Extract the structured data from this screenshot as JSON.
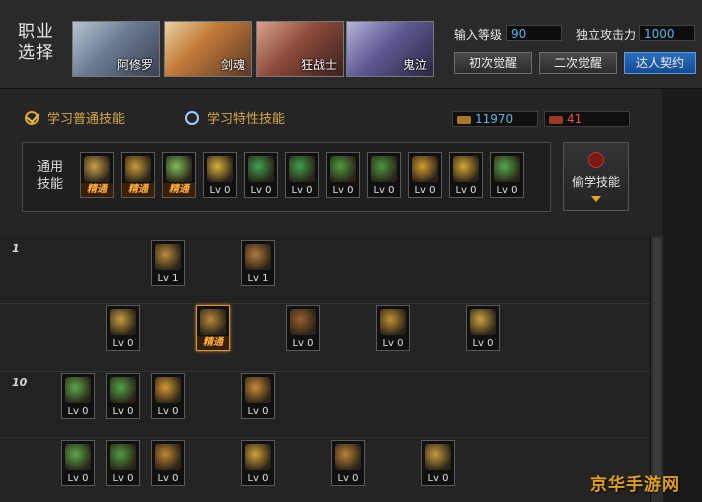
{
  "header": {
    "job_label": "职业选择",
    "portraits": [
      {
        "name": "阿修罗",
        "color": "#7b8aa3"
      },
      {
        "name": "剑魂",
        "color": "#c28a45"
      },
      {
        "name": "狂战士",
        "color": "#9a5a4a"
      },
      {
        "name": "鬼泣",
        "color": "#6d6aa0"
      }
    ],
    "level_label": "输入等级",
    "level_value": "90",
    "attack_label": "独立攻击力",
    "attack_value": "1000",
    "buttons": [
      "初次觉醒",
      "二次觉醒",
      "达人契约"
    ]
  },
  "tabs": {
    "normal": "学习普通技能",
    "special": "学习特性技能"
  },
  "currency": {
    "sp": "11970",
    "tp": "41"
  },
  "common": {
    "label": "通用技能",
    "skills": [
      {
        "icon": "sit-icon",
        "lv": "精通",
        "mastery": true,
        "color": "#c9a24a"
      },
      {
        "icon": "kneel-icon",
        "lv": "精通",
        "mastery": true,
        "color": "#c99a3a"
      },
      {
        "icon": "leap-icon",
        "lv": "精通",
        "mastery": true,
        "color": "#7fbf5a"
      },
      {
        "icon": "wings-icon",
        "lv": "Lv 0",
        "mastery": false,
        "color": "#d7b13c"
      },
      {
        "icon": "target-icon",
        "lv": "Lv 0",
        "mastery": false,
        "color": "#3fa04f"
      },
      {
        "icon": "crosshair-icon",
        "lv": "Lv 0",
        "mastery": false,
        "color": "#3f9f4a"
      },
      {
        "icon": "fighter-icon",
        "lv": "Lv 0",
        "mastery": false,
        "color": "#4e9a3c"
      },
      {
        "icon": "fighter-gear-icon",
        "lv": "Lv 0",
        "mastery": false,
        "color": "#4d9641"
      },
      {
        "icon": "vortex-icon",
        "lv": "Lv 0",
        "mastery": false,
        "color": "#d59b2e"
      },
      {
        "icon": "flex-icon",
        "lv": "Lv 0",
        "mastery": false,
        "color": "#d6a733"
      },
      {
        "icon": "runner-icon",
        "lv": "Lv 0",
        "mastery": false,
        "color": "#58a84c"
      }
    ],
    "steal_label": "偷学技能"
  },
  "tree": {
    "levels": [
      "1",
      "10"
    ],
    "rows": [
      [
        {
          "icon": "slash-icon",
          "lv": "Lv 1",
          "mastery": false,
          "color": "#b98a3a"
        },
        {
          "icon": "arc-slash-icon",
          "lv": "Lv 1",
          "mastery": false,
          "color": "#b07a3a"
        }
      ],
      [
        {
          "icon": "feather-icon",
          "lv": "Lv 0",
          "mastery": false,
          "color": "#c49a3e"
        },
        {
          "icon": "arrow-dash-icon",
          "lv": "精通",
          "mastery": true,
          "color": "#b8863a",
          "sel": true
        },
        {
          "icon": "wave-icon",
          "lv": "Lv 0",
          "mastery": false,
          "color": "#9a5e2c"
        },
        {
          "icon": "shield-icon",
          "lv": "Lv 0",
          "mastery": false,
          "color": "#c38f33"
        },
        {
          "icon": "trident-icon",
          "lv": "Lv 0",
          "mastery": false,
          "color": "#c9a141"
        }
      ],
      [
        {
          "icon": "green-blade-icon",
          "lv": "Lv 0",
          "mastery": false,
          "color": "#5ba84a"
        },
        {
          "icon": "green-sword-icon",
          "lv": "Lv 0",
          "mastery": false,
          "color": "#52a044"
        },
        {
          "icon": "flame-burst-icon",
          "lv": "Lv 0",
          "mastery": false,
          "color": "#d49a30"
        },
        {
          "icon": "spiral-icon",
          "lv": "Lv 0",
          "mastery": false,
          "color": "#c88a34"
        }
      ],
      [
        {
          "icon": "green-edge-icon",
          "lv": "Lv 0",
          "mastery": false,
          "color": "#5da94a"
        },
        {
          "icon": "star-burst-icon",
          "lv": "Lv 0",
          "mastery": false,
          "color": "#4f9c40"
        },
        {
          "icon": "swirl-icon",
          "lv": "Lv 0",
          "mastery": false,
          "color": "#c08434"
        },
        {
          "icon": "cross-spark-icon",
          "lv": "Lv 0",
          "mastery": false,
          "color": "#d2a23a"
        },
        {
          "icon": "crescent-icon",
          "lv": "Lv 0",
          "mastery": false,
          "color": "#b98236"
        },
        {
          "icon": "gust-icon",
          "lv": "Lv 0",
          "mastery": false,
          "color": "#c99a40"
        }
      ]
    ]
  },
  "watermark": "京华手游网"
}
